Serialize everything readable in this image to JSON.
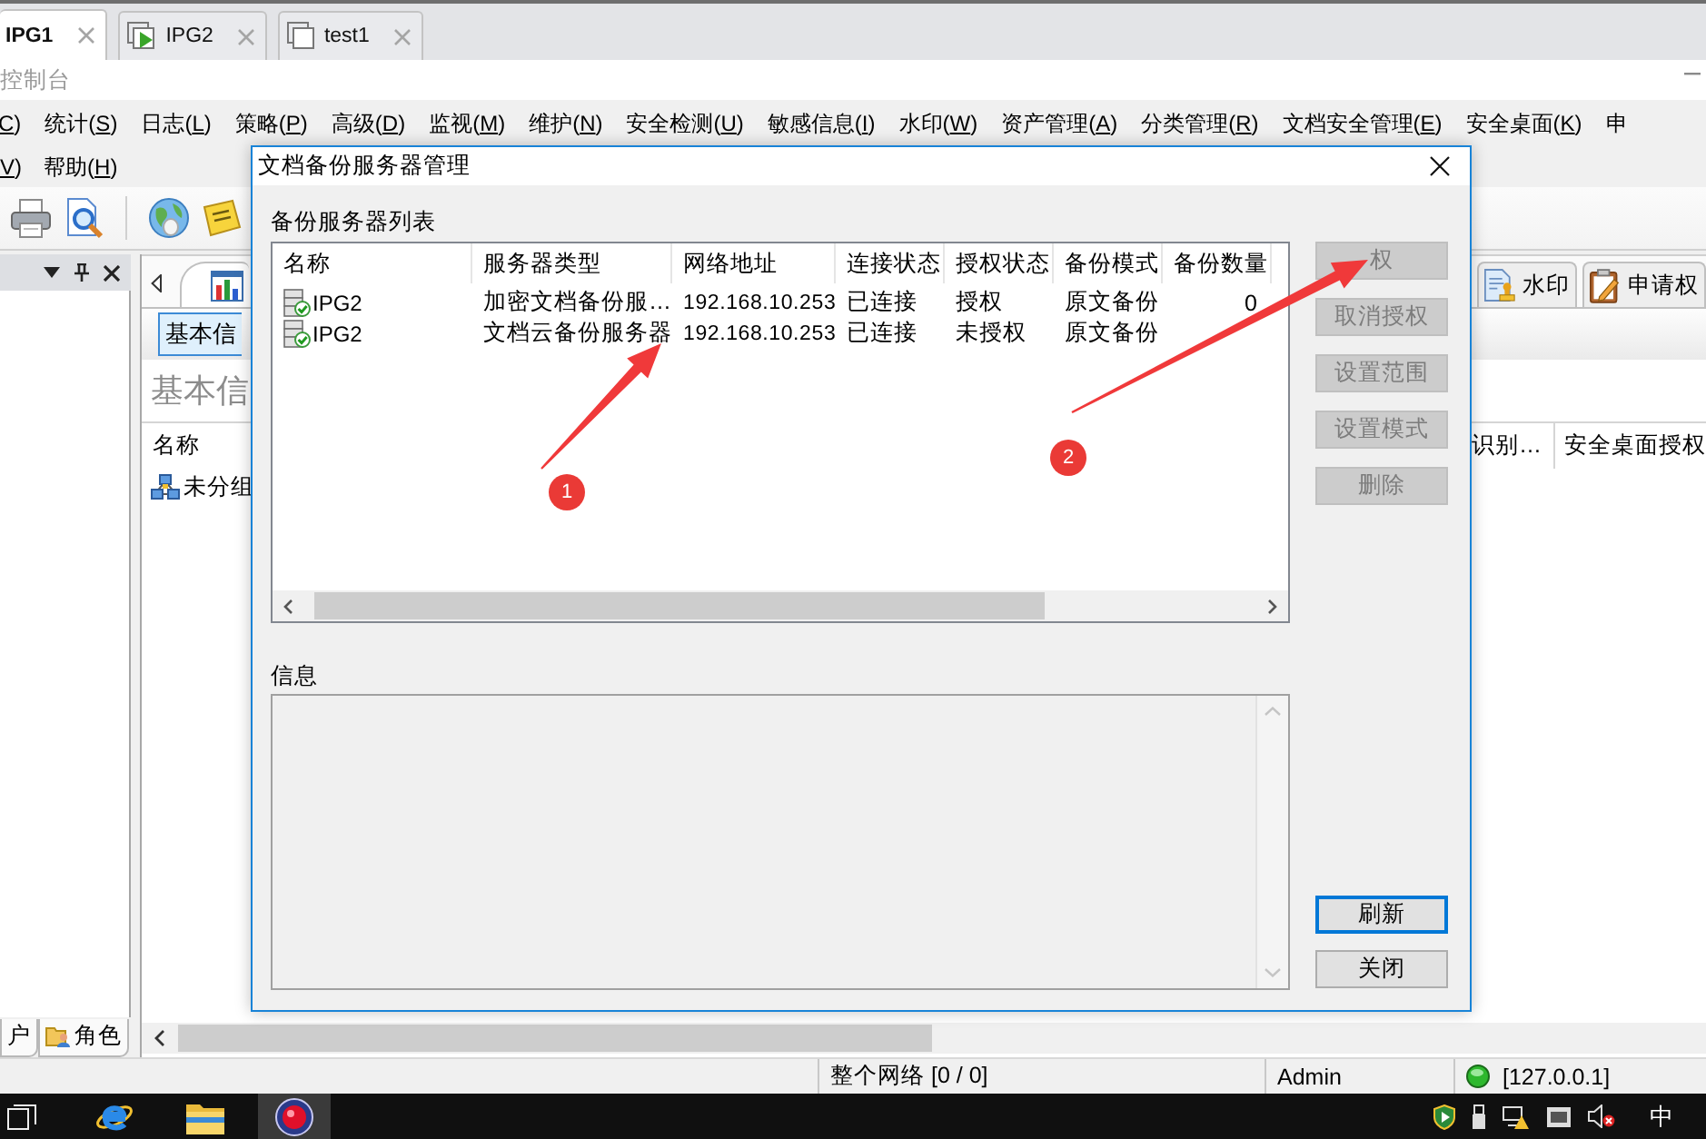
{
  "top_tabs": [
    {
      "label": "IPG1",
      "selected": true,
      "kind": "plain"
    },
    {
      "label": "IPG2",
      "selected": false,
      "kind": "running"
    },
    {
      "label": "test1",
      "selected": false,
      "kind": "idle"
    }
  ],
  "console_title": "控制台",
  "menu_bar": {
    "rows": [
      [
        {
          "key": "C",
          "end": ")"
        },
        {
          "label": "统计(",
          "key": "S",
          "end": ")"
        },
        {
          "label": "日志(",
          "key": "L",
          "end": ")"
        },
        {
          "label": "策略(",
          "key": "P",
          "end": ")"
        },
        {
          "label": "高级(",
          "key": "D",
          "end": ")"
        },
        {
          "label": "监视(",
          "key": "M",
          "end": ")"
        },
        {
          "label": "维护(",
          "key": "N",
          "end": ")"
        },
        {
          "label": "安全检测(",
          "key": "U",
          "end": ")"
        },
        {
          "label": "敏感信息(",
          "key": "I",
          "end": ")"
        },
        {
          "label": "水印(",
          "key": "W",
          "end": ")"
        },
        {
          "label": "资产管理(",
          "key": "A",
          "end": ")"
        },
        {
          "label": "分类管理(",
          "key": "R",
          "end": ")"
        },
        {
          "label": "文档安全管理(",
          "key": "E",
          "end": ")"
        },
        {
          "label": "安全桌面(",
          "key": "K",
          "end": ")"
        },
        {
          "label": "申"
        }
      ],
      [
        {
          "key": "V",
          "end": ")"
        },
        {
          "label": "帮助(",
          "key": "H",
          "end": ")"
        }
      ]
    ]
  },
  "left_panel": {
    "tabs": [
      {
        "label": "户",
        "kind": "plain"
      },
      {
        "label": "角色",
        "kind": "role"
      }
    ]
  },
  "workspace": {
    "doc_tabs": [
      {
        "kind": "chart",
        "selected": true
      },
      {
        "label": "水印",
        "kind": "stamp",
        "selected": false
      },
      {
        "label": "申请权",
        "kind": "clipboard",
        "selected": false
      }
    ],
    "info_button": "基本信",
    "heading": "基本信",
    "left_columns": [
      "名称"
    ],
    "right_columns": [
      "识别…",
      "安全桌面授权"
    ],
    "groups": [
      {
        "label": "未分组"
      }
    ]
  },
  "dialog": {
    "title": "文档备份服务器管理",
    "list_label": "备份服务器列表",
    "columns": [
      "名称",
      "服务器类型",
      "网络地址",
      "连接状态",
      "授权状态",
      "备份模式",
      "备份数量"
    ],
    "rows": [
      {
        "name": "IPG2",
        "type": "加密文档备份服…",
        "address": "192.168.10.253",
        "connection": "已连接",
        "auth": "授权",
        "mode": "原文备份",
        "count": "0"
      },
      {
        "name": "IPG2",
        "type": "文档云备份服务器",
        "address": "192.168.10.253",
        "connection": "已连接",
        "auth": "未授权",
        "mode": "原文备份"
      }
    ],
    "action_buttons": [
      {
        "label": "权",
        "disabled": true
      },
      {
        "label": "取消授权",
        "disabled": true
      },
      {
        "label": "设置范围",
        "disabled": true
      },
      {
        "label": "设置模式",
        "disabled": true
      },
      {
        "label": "删除",
        "disabled": true
      }
    ],
    "info_label": "信息",
    "footer_buttons": [
      {
        "label": "刷新",
        "focused": true
      },
      {
        "label": "关闭",
        "focused": false
      }
    ]
  },
  "annotations": [
    {
      "label": "1"
    },
    {
      "label": "2"
    }
  ],
  "status_bar": {
    "network": "整个网络 [0 / 0]",
    "user": "Admin",
    "address": "[127.0.0.1]"
  },
  "taskbar": {
    "input_method": "中"
  }
}
